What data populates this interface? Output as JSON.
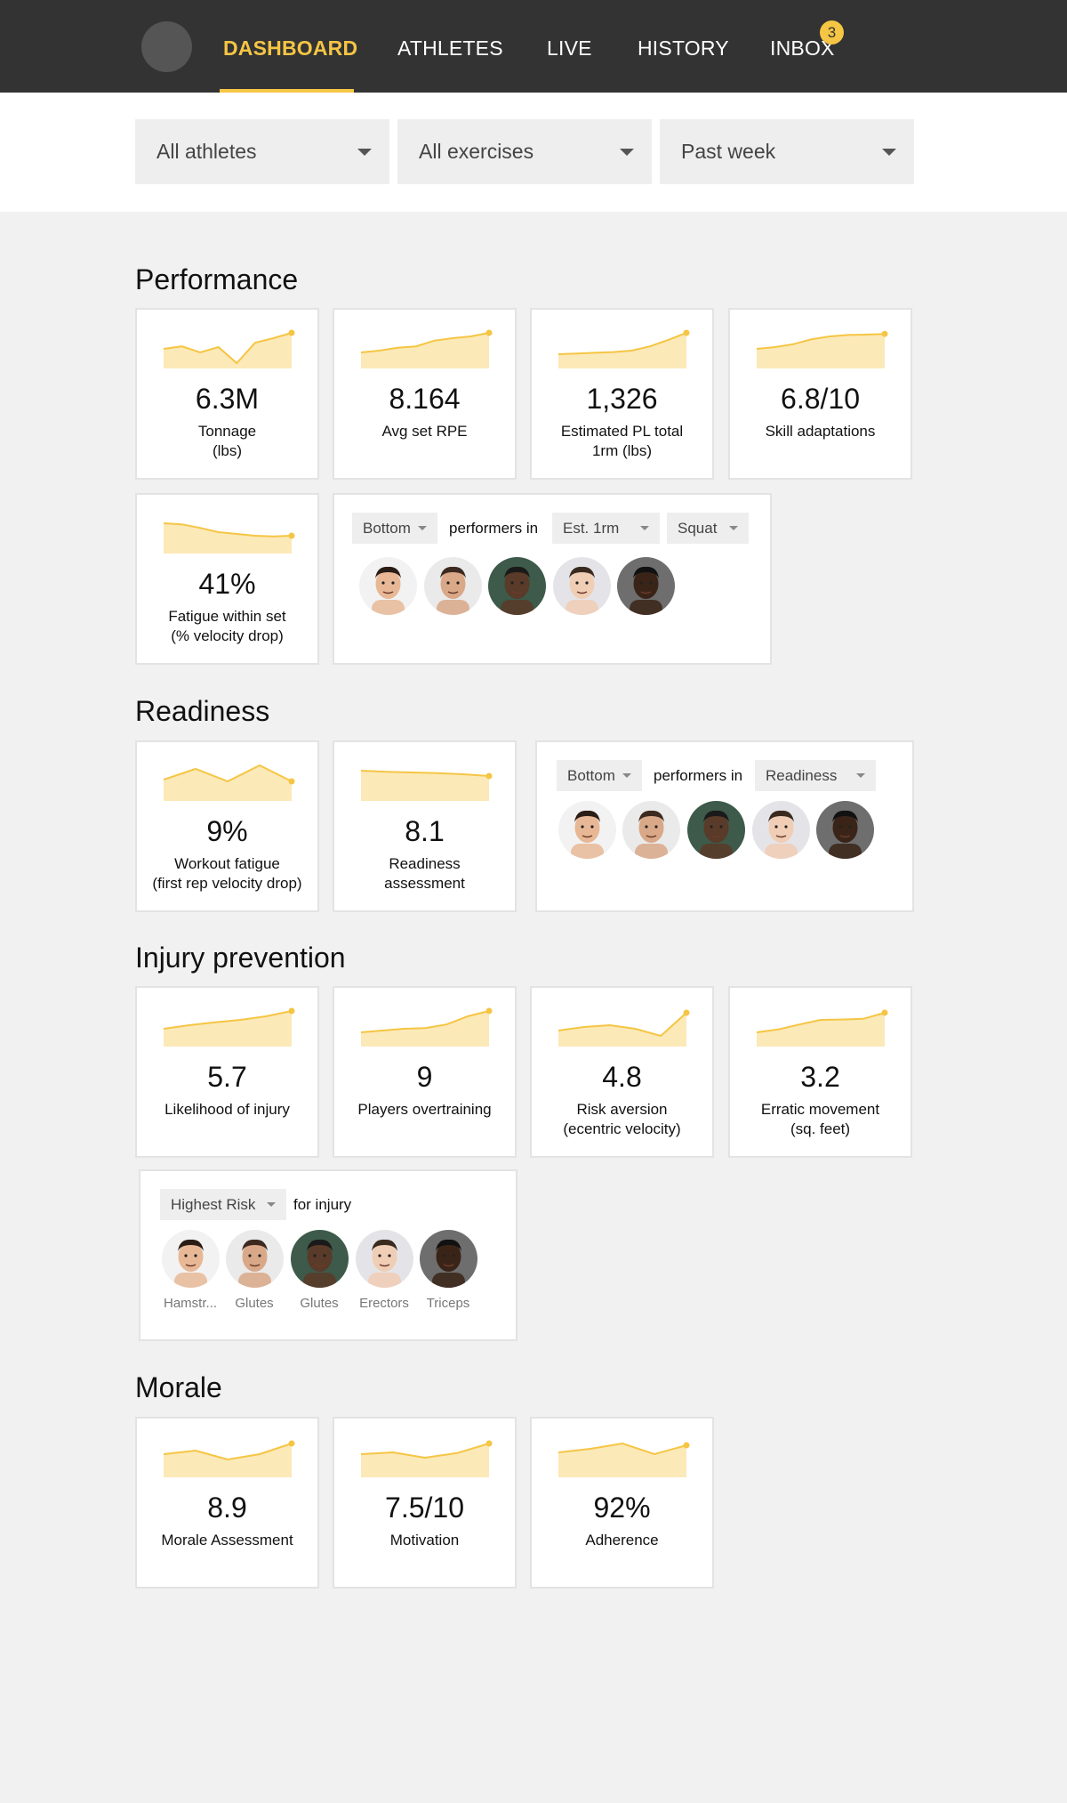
{
  "nav": {
    "items": [
      "DASHBOARD",
      "ATHLETES",
      "LIVE",
      "HISTORY",
      "INBOX"
    ],
    "inbox_badge": "3",
    "accent": "#f5c544",
    "bg": "#333333"
  },
  "filters": {
    "athletes": "All athletes",
    "exercises": "All exercises",
    "period": "Past week"
  },
  "sections": {
    "performance": {
      "title": "Performance",
      "cards": [
        {
          "value": "6.3M",
          "label": "Tonnage\n(lbs)",
          "trend": [
            0.55,
            0.62,
            0.45,
            0.6,
            0.15,
            0.72,
            0.85,
            1.0
          ]
        },
        {
          "value": "8.164",
          "label": "Avg set RPE",
          "trend": [
            0.45,
            0.5,
            0.58,
            0.62,
            0.78,
            0.85,
            0.9,
            1.0
          ]
        },
        {
          "value": "1,326",
          "label": "Estimated PL total\n1rm (lbs)",
          "trend": [
            0.4,
            0.42,
            0.44,
            0.46,
            0.5,
            0.62,
            0.8,
            1.0
          ]
        },
        {
          "value": "6.8/10",
          "label": "Skill adaptations",
          "trend": [
            0.55,
            0.6,
            0.68,
            0.82,
            0.9,
            0.94,
            0.95,
            0.97
          ]
        },
        {
          "value": "41%",
          "label": "Fatigue within set\n(% velocity drop)",
          "trend": [
            0.85,
            0.82,
            0.72,
            0.6,
            0.55,
            0.5,
            0.48,
            0.5
          ]
        }
      ],
      "performers": {
        "rank": "Bottom",
        "middle_text": "performers in",
        "metric": "Est. 1rm",
        "exercise": "Squat"
      }
    },
    "readiness": {
      "title": "Readiness",
      "cards": [
        {
          "value": "9%",
          "label": "Workout fatigue\n(first rep velocity drop)",
          "trend": [
            0.6,
            0.9,
            0.55,
            1.0,
            0.55
          ]
        },
        {
          "value": "8.1",
          "label": "Readiness\nassessment",
          "trend": [
            0.85,
            0.82,
            0.8,
            0.78,
            0.75,
            0.7
          ]
        }
      ],
      "performers": {
        "rank": "Bottom",
        "middle_text": "performers in",
        "metric": "Readiness"
      }
    },
    "injury": {
      "title": "Injury prevention",
      "cards": [
        {
          "value": "5.7",
          "label": "Likelihood of injury",
          "trend": [
            0.5,
            0.6,
            0.68,
            0.75,
            0.85,
            1.0
          ]
        },
        {
          "value": "9",
          "label": "Players overtraining",
          "trend": [
            0.4,
            0.45,
            0.5,
            0.52,
            0.62,
            0.85,
            1.0
          ]
        },
        {
          "value": "4.8",
          "label": "Risk aversion\n(ecentric velocity)",
          "trend": [
            0.45,
            0.55,
            0.6,
            0.5,
            0.3,
            0.95
          ]
        },
        {
          "value": "3.2",
          "label": "Erratic movement\n(sq. feet)",
          "trend": [
            0.4,
            0.48,
            0.62,
            0.75,
            0.76,
            0.78,
            0.95
          ]
        }
      ],
      "risk": {
        "rank": "Highest Risk",
        "suffix": "for injury",
        "captions": [
          "Hamstr...",
          "Glutes",
          "Glutes",
          "Erectors",
          "Triceps"
        ]
      }
    },
    "morale": {
      "title": "Morale",
      "cards": [
        {
          "value": "8.9",
          "label": "Morale Assessment",
          "trend": [
            0.65,
            0.75,
            0.5,
            0.65,
            0.95
          ]
        },
        {
          "value": "7.5/10",
          "label": "Motivation",
          "trend": [
            0.65,
            0.7,
            0.55,
            0.68,
            0.95
          ]
        },
        {
          "value": "92%",
          "label": "Adherence",
          "trend": [
            0.7,
            0.8,
            0.95,
            0.65,
            0.9
          ]
        }
      ]
    }
  },
  "faces": [
    {
      "skin": "#e8b896",
      "hair": "#2a1d16",
      "bg": "#f2f2f2",
      "name": "athlete-1"
    },
    {
      "skin": "#d9a888",
      "hair": "#3c2a20",
      "bg": "#eaeaea",
      "name": "athlete-2"
    },
    {
      "skin": "#5a3a28",
      "hair": "#1a1a1a",
      "bg": "#3d5a4a",
      "name": "athlete-3"
    },
    {
      "skin": "#f0cdb5",
      "hair": "#3a2a1e",
      "bg": "#e4e4e8",
      "name": "athlete-4"
    },
    {
      "skin": "#3a2418",
      "hair": "#111111",
      "bg": "#6e6e6e",
      "name": "athlete-5"
    }
  ]
}
